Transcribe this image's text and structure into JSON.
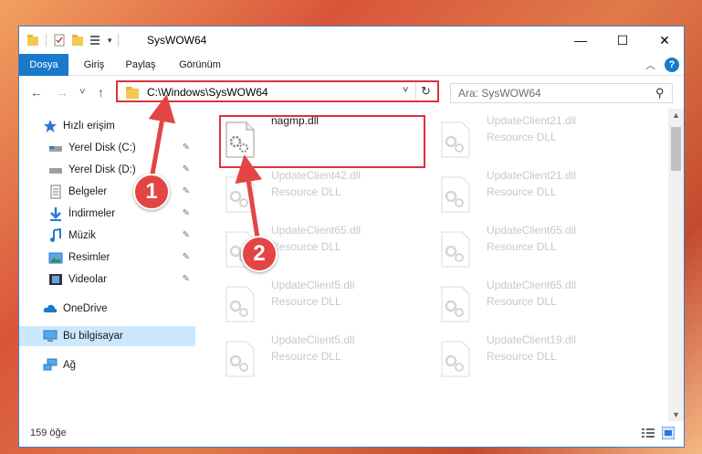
{
  "window": {
    "title": "SysWOW64",
    "minimize_glyph": "—",
    "maximize_glyph": "☐",
    "close_glyph": "✕"
  },
  "ribbon": {
    "tabs": [
      {
        "label": "Dosya"
      },
      {
        "label": "Giriş"
      },
      {
        "label": "Paylaş"
      },
      {
        "label": "Görünüm"
      }
    ],
    "collapse_glyph": "︿",
    "help_glyph": "?"
  },
  "nav": {
    "back": "←",
    "forward": "→",
    "recent": "˅",
    "up": "↑",
    "address": "C:\\Windows\\SysWOW64",
    "refresh": "↻",
    "dropdown": "˅",
    "search_placeholder": "Ara: SysWOW64",
    "search_icon": "⚲"
  },
  "sidebar": {
    "items": [
      {
        "label": "Hızlı erişim",
        "icon": "star-icon",
        "pinned": false
      },
      {
        "label": "Yerel Disk (C:)",
        "icon": "drive-icon",
        "pinned": true
      },
      {
        "label": "Yerel Disk (D:)",
        "icon": "drive-icon",
        "pinned": true
      },
      {
        "label": "Belgeler",
        "icon": "documents-icon",
        "pinned": true
      },
      {
        "label": "İndirmeler",
        "icon": "download-icon",
        "pinned": true
      },
      {
        "label": "Müzik",
        "icon": "music-icon",
        "pinned": true
      },
      {
        "label": "Resimler",
        "icon": "pictures-icon",
        "pinned": true
      },
      {
        "label": "Videolar",
        "icon": "videos-icon",
        "pinned": true
      },
      {
        "label": "OneDrive",
        "icon": "cloud-icon",
        "pinned": false
      },
      {
        "label": "Bu bilgisayar",
        "icon": "computer-icon",
        "pinned": false,
        "selected": true
      },
      {
        "label": "Ağ",
        "icon": "network-icon",
        "pinned": false
      }
    ],
    "pin_glyph": "📌"
  },
  "files": {
    "left": [
      {
        "name": "nagmp.dll",
        "type": "",
        "highlighted": true
      },
      {
        "name": "UpdateClient42.dll",
        "type": "Resource DLL"
      },
      {
        "name": "UpdateClient65.dll",
        "type": "Resource DLL"
      },
      {
        "name": "UpdateClient5.dll",
        "type": "Resource DLL"
      },
      {
        "name": "UpdateClient5.dll",
        "type": "Resource DLL"
      }
    ],
    "right": [
      {
        "name": "UpdateClient21.dll",
        "type": "Resource DLL"
      },
      {
        "name": "UpdateClient21.dll",
        "type": "Resource DLL"
      },
      {
        "name": "UpdateClient65.dll",
        "type": "Resource DLL"
      },
      {
        "name": "UpdateClient65.dll",
        "type": "Resource DLL"
      },
      {
        "name": "UpdateClient19.dll",
        "type": "Resource DLL"
      }
    ]
  },
  "status": {
    "count": "159 öğe"
  },
  "annotations": {
    "badge1": "1",
    "badge2": "2"
  },
  "colors": {
    "accent": "#1979ca",
    "highlight": "#d9333f",
    "selected": "#cce8ff"
  }
}
